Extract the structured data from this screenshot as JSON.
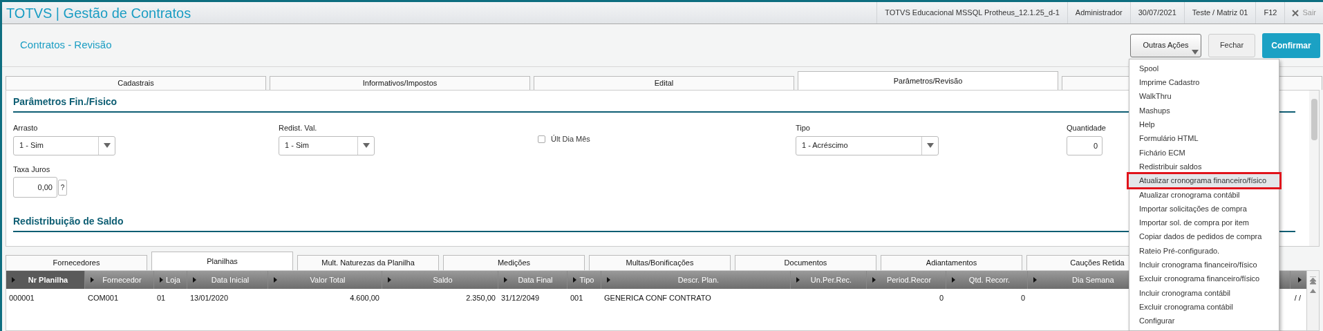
{
  "header": {
    "title": "TOTVS | Gestão de Contratos",
    "info": [
      "TOTVS Educacional MSSQL Protheus_12.1.25_d-1",
      "Administrador",
      "30/07/2021",
      "Teste / Matriz 01",
      "F12"
    ],
    "exit": "Sair"
  },
  "page": {
    "title": "Contratos - Revisão",
    "buttons": [
      {
        "label": "Outras Ações",
        "kind": "dropdown"
      },
      {
        "label": "Fechar",
        "kind": "plain"
      },
      {
        "label": "Confirmar",
        "kind": "primary"
      }
    ]
  },
  "tabs": [
    {
      "label": "Cadastrais",
      "selected": false
    },
    {
      "label": "Informativos/Impostos",
      "selected": false
    },
    {
      "label": "Edital",
      "selected": false
    },
    {
      "label": "Parâmetros/Revisão",
      "selected": true
    }
  ],
  "sections": [
    {
      "title": "Parâmetros Fin./Fisico"
    },
    {
      "title": "Redistribuição de Saldo"
    }
  ],
  "fields": {
    "arrasto": {
      "label": "Arrasto",
      "value": "1 - Sim"
    },
    "redist": {
      "label": "Redist. Val.",
      "value": "1 - Sim"
    },
    "ult_dia": {
      "label": "Últ Dia Mês",
      "checked": false
    },
    "tipo": {
      "label": "Tipo",
      "value": "1 - Acréscimo"
    },
    "quantidade": {
      "label": "Quantidade",
      "value": "0"
    },
    "taxa": {
      "label": "Taxa Juros",
      "value": "0,00",
      "help": "?"
    }
  },
  "bottom_tabs": [
    {
      "label": "Fornecedores",
      "selected": false
    },
    {
      "label": "Planilhas",
      "selected": true
    },
    {
      "label": "Mult. Naturezas da Planilha",
      "selected": false
    },
    {
      "label": "Medições",
      "selected": false
    },
    {
      "label": "Multas/Bonificações",
      "selected": false
    },
    {
      "label": "Documentos",
      "selected": false
    },
    {
      "label": "Adiantamentos",
      "selected": false
    },
    {
      "label": "Cauções Retida",
      "selected": false
    }
  ],
  "table": {
    "columns": [
      {
        "label": "Nr Planilha",
        "selected": true
      },
      {
        "label": "Fornecedor",
        "selected": false
      },
      {
        "label": "Loja",
        "selected": false
      },
      {
        "label": "Data Inicial",
        "selected": false
      },
      {
        "label": "Valor Total",
        "selected": false
      },
      {
        "label": "Saldo",
        "selected": false
      },
      {
        "label": "Data Final",
        "selected": false
      },
      {
        "label": "Tipo",
        "selected": false
      },
      {
        "label": "Descr. Plan.",
        "selected": false
      },
      {
        "label": "Un.Per.Rec.",
        "selected": false
      },
      {
        "label": "Period.Recor",
        "selected": false
      },
      {
        "label": "Qtd. Recorr.",
        "selected": false
      },
      {
        "label": "Dia Semana",
        "selected": false
      }
    ],
    "rows": [
      [
        "000001",
        "COM001",
        "01",
        "13/01/2020",
        "4.600,00",
        "2.350,00",
        "31/12/2049",
        "001",
        "GENERICA CONF CONTRATO",
        "",
        "0",
        "0",
        "",
        "/ /"
      ]
    ]
  },
  "menu": [
    {
      "label": "Spool",
      "selected": false
    },
    {
      "label": "Imprime Cadastro",
      "selected": false
    },
    {
      "label": "WalkThru",
      "selected": false
    },
    {
      "label": "Mashups",
      "selected": false
    },
    {
      "label": "Help",
      "selected": false
    },
    {
      "label": "Formulário HTML",
      "selected": false
    },
    {
      "label": "Fichário ECM",
      "selected": false
    },
    {
      "label": "Redistribuir saldos",
      "selected": false
    },
    {
      "label": "Atualizar cronograma financeiro/físico",
      "selected": true
    },
    {
      "label": "Atualizar cronograma contábil",
      "selected": false
    },
    {
      "label": "Importar solicitações de compra",
      "selected": false
    },
    {
      "label": "Importar sol. de compra por item",
      "selected": false
    },
    {
      "label": "Copiar dados de pedidos de compra",
      "selected": false
    },
    {
      "label": "Rateio Pré-configurado.",
      "selected": false
    },
    {
      "label": "Incluir cronograma financeiro/físico",
      "selected": false
    },
    {
      "label": "Excluir cronograma financeiro/físico",
      "selected": false
    },
    {
      "label": "Incluir cronograma contábil",
      "selected": false
    },
    {
      "label": "Excluir cronograma contábil",
      "selected": false
    },
    {
      "label": "Configurar",
      "selected": false
    }
  ]
}
